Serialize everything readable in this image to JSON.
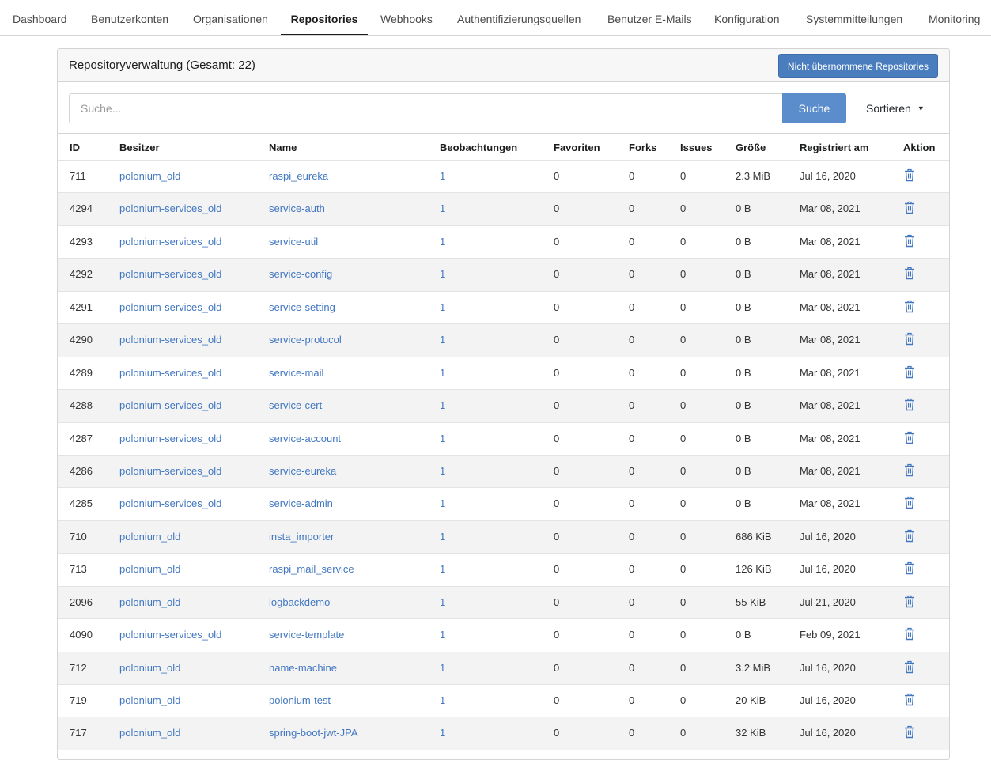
{
  "nav": {
    "tabs": [
      {
        "label": "Dashboard",
        "active": false
      },
      {
        "label": "Benutzerkonten",
        "active": false
      },
      {
        "label": "Organisationen",
        "active": false
      },
      {
        "label": "Repositories",
        "active": true
      },
      {
        "label": "Webhooks",
        "active": false
      },
      {
        "label": "Authentifizierungsquellen",
        "active": false
      },
      {
        "label": "Benutzer E-Mails",
        "active": false
      },
      {
        "label": "Konfiguration",
        "active": false
      },
      {
        "label": "Systemmitteilungen",
        "active": false
      },
      {
        "label": "Monitoring",
        "active": false
      }
    ]
  },
  "panel": {
    "title": "Repositoryverwaltung (Gesamt: 22)",
    "unadopted_label": "Nicht übernommene Repositories"
  },
  "search": {
    "placeholder": "Suche...",
    "value": "",
    "button_label": "Suche",
    "sort_label": "Sortieren",
    "sort_caret_icon": "caret-down-icon"
  },
  "table": {
    "headers": {
      "id": "ID",
      "owner": "Besitzer",
      "name": "Name",
      "watchers": "Beobachtungen",
      "stars": "Favoriten",
      "forks": "Forks",
      "issues": "Issues",
      "size": "Größe",
      "created": "Registriert am",
      "action": "Aktion"
    },
    "action_icon": "trash-icon",
    "rows": [
      {
        "id": "711",
        "owner": "polonium_old",
        "name": "raspi_eureka",
        "watchers": "1",
        "stars": "0",
        "forks": "0",
        "issues": "0",
        "size": "2.3 MiB",
        "created": "Jul 16, 2020"
      },
      {
        "id": "4294",
        "owner": "polonium-services_old",
        "name": "service-auth",
        "watchers": "1",
        "stars": "0",
        "forks": "0",
        "issues": "0",
        "size": "0 B",
        "created": "Mar 08, 2021"
      },
      {
        "id": "4293",
        "owner": "polonium-services_old",
        "name": "service-util",
        "watchers": "1",
        "stars": "0",
        "forks": "0",
        "issues": "0",
        "size": "0 B",
        "created": "Mar 08, 2021"
      },
      {
        "id": "4292",
        "owner": "polonium-services_old",
        "name": "service-config",
        "watchers": "1",
        "stars": "0",
        "forks": "0",
        "issues": "0",
        "size": "0 B",
        "created": "Mar 08, 2021"
      },
      {
        "id": "4291",
        "owner": "polonium-services_old",
        "name": "service-setting",
        "watchers": "1",
        "stars": "0",
        "forks": "0",
        "issues": "0",
        "size": "0 B",
        "created": "Mar 08, 2021"
      },
      {
        "id": "4290",
        "owner": "polonium-services_old",
        "name": "service-protocol",
        "watchers": "1",
        "stars": "0",
        "forks": "0",
        "issues": "0",
        "size": "0 B",
        "created": "Mar 08, 2021"
      },
      {
        "id": "4289",
        "owner": "polonium-services_old",
        "name": "service-mail",
        "watchers": "1",
        "stars": "0",
        "forks": "0",
        "issues": "0",
        "size": "0 B",
        "created": "Mar 08, 2021"
      },
      {
        "id": "4288",
        "owner": "polonium-services_old",
        "name": "service-cert",
        "watchers": "1",
        "stars": "0",
        "forks": "0",
        "issues": "0",
        "size": "0 B",
        "created": "Mar 08, 2021"
      },
      {
        "id": "4287",
        "owner": "polonium-services_old",
        "name": "service-account",
        "watchers": "1",
        "stars": "0",
        "forks": "0",
        "issues": "0",
        "size": "0 B",
        "created": "Mar 08, 2021"
      },
      {
        "id": "4286",
        "owner": "polonium-services_old",
        "name": "service-eureka",
        "watchers": "1",
        "stars": "0",
        "forks": "0",
        "issues": "0",
        "size": "0 B",
        "created": "Mar 08, 2021"
      },
      {
        "id": "4285",
        "owner": "polonium-services_old",
        "name": "service-admin",
        "watchers": "1",
        "stars": "0",
        "forks": "0",
        "issues": "0",
        "size": "0 B",
        "created": "Mar 08, 2021"
      },
      {
        "id": "710",
        "owner": "polonium_old",
        "name": "insta_importer",
        "watchers": "1",
        "stars": "0",
        "forks": "0",
        "issues": "0",
        "size": "686 KiB",
        "created": "Jul 16, 2020"
      },
      {
        "id": "713",
        "owner": "polonium_old",
        "name": "raspi_mail_service",
        "watchers": "1",
        "stars": "0",
        "forks": "0",
        "issues": "0",
        "size": "126 KiB",
        "created": "Jul 16, 2020"
      },
      {
        "id": "2096",
        "owner": "polonium_old",
        "name": "logbackdemo",
        "watchers": "1",
        "stars": "0",
        "forks": "0",
        "issues": "0",
        "size": "55 KiB",
        "created": "Jul 21, 2020"
      },
      {
        "id": "4090",
        "owner": "polonium-services_old",
        "name": "service-template",
        "watchers": "1",
        "stars": "0",
        "forks": "0",
        "issues": "0",
        "size": "0 B",
        "created": "Feb 09, 2021"
      },
      {
        "id": "712",
        "owner": "polonium_old",
        "name": "name-machine",
        "watchers": "1",
        "stars": "0",
        "forks": "0",
        "issues": "0",
        "size": "3.2 MiB",
        "created": "Jul 16, 2020"
      },
      {
        "id": "719",
        "owner": "polonium_old",
        "name": "polonium-test",
        "watchers": "1",
        "stars": "0",
        "forks": "0",
        "issues": "0",
        "size": "20 KiB",
        "created": "Jul 16, 2020"
      },
      {
        "id": "717",
        "owner": "polonium_old",
        "name": "spring-boot-jwt-JPA",
        "watchers": "1",
        "stars": "0",
        "forks": "0",
        "issues": "0",
        "size": "32 KiB",
        "created": "Jul 16, 2020"
      }
    ]
  }
}
